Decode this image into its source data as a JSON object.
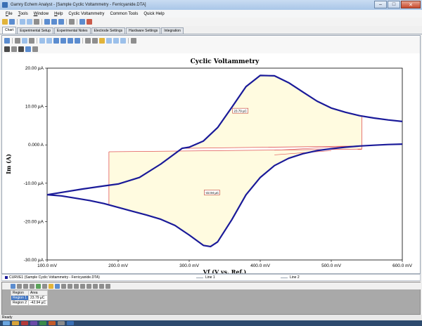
{
  "window": {
    "title": "Gamry Echem Analyst - [Sample Cyclic Voltammetry - Ferricyanide.DTA]",
    "minimize_glyph": "–",
    "maximize_glyph": "□",
    "close_glyph": "✕"
  },
  "menu": {
    "items": [
      {
        "key": "F",
        "rest": "ile"
      },
      {
        "key": "T",
        "rest": "ools"
      },
      {
        "key": "W",
        "rest": "indow"
      },
      {
        "key": "H",
        "rest": "elp"
      },
      {
        "key": "",
        "rest": "Cyclic Voltammetry"
      },
      {
        "key": "",
        "rest": "Common Tools"
      },
      {
        "key": "",
        "rest": "Quick Help"
      }
    ]
  },
  "tabs": [
    {
      "label": "Chart",
      "active": true
    },
    {
      "label": "Experimental Setup",
      "active": false
    },
    {
      "label": "Experimental Notes",
      "active": false
    },
    {
      "label": "Electrode Settings",
      "active": false
    },
    {
      "label": "Hardware Settings",
      "active": false
    },
    {
      "label": "Integration",
      "active": false
    }
  ],
  "chart_data": {
    "type": "line",
    "title": "Cyclic Voltammetry",
    "xlabel": "Vf (V vs. Ref.)",
    "ylabel": "Im (A)",
    "xlim": [
      100,
      600
    ],
    "ylim": [
      -30,
      20
    ],
    "x_unit": "mV",
    "y_unit": "µA",
    "x_ticks": [
      {
        "value": 100,
        "label": "100.0 mV"
      },
      {
        "value": 200,
        "label": "200.0 mV"
      },
      {
        "value": 300,
        "label": "300.0 mV"
      },
      {
        "value": 400,
        "label": "400.0 mV"
      },
      {
        "value": 500,
        "label": "500.0 mV"
      },
      {
        "value": 600,
        "label": "600.0 mV"
      }
    ],
    "y_ticks": [
      {
        "value": 20,
        "label": "20.00 µA"
      },
      {
        "value": 10,
        "label": "10.00 µA"
      },
      {
        "value": 0,
        "label": "0.000 A"
      },
      {
        "value": -10,
        "label": "-10.00 µA"
      },
      {
        "value": -20,
        "label": "-20.00 µA"
      },
      {
        "value": -30,
        "label": "-30.00 µA"
      }
    ],
    "series": [
      {
        "name": "CURVE1 (Sample Cyclic Voltammetry - Ferricyanide.DTA)",
        "color": "#1a1a99",
        "x": [
          100,
          120,
          150,
          180,
          200,
          230,
          260,
          290,
          300,
          320,
          340,
          360,
          380,
          400,
          420,
          440,
          460,
          480,
          500,
          520,
          540,
          560,
          580,
          600
        ],
        "y": [
          -13,
          -12.4,
          -11.5,
          -10.7,
          -10.2,
          -8.5,
          -5.0,
          -0.9,
          -0.6,
          1.0,
          4.5,
          9.8,
          15.2,
          18.1,
          18.0,
          16.2,
          13.8,
          11.4,
          9.6,
          8.5,
          7.6,
          7.0,
          6.5,
          6.1
        ]
      },
      {
        "name": "",
        "color": "#1a1a99",
        "x": [
          600,
          580,
          560,
          540,
          520,
          500,
          480,
          460,
          440,
          420,
          400,
          380,
          360,
          340,
          330,
          320,
          300,
          280,
          260,
          240,
          220,
          200,
          180,
          160,
          140,
          120,
          100
        ],
        "y": [
          0.2,
          0.1,
          -0.1,
          -0.3,
          -0.6,
          -1.0,
          -1.5,
          -2.3,
          -3.5,
          -5.4,
          -8.5,
          -13.0,
          -19.5,
          -25.3,
          -26.5,
          -26.2,
          -23.5,
          -21.0,
          -19.4,
          -18.3,
          -17.3,
          -16.3,
          -15.3,
          -14.5,
          -13.9,
          -13.3,
          -13
        ]
      }
    ],
    "regions": [
      {
        "label": "23.79 µC",
        "color": "#fffbe0",
        "x_range": [
          289,
          543
        ],
        "baseline": [
          [
            289,
            -0.9
          ],
          [
            543,
            -0.3
          ]
        ]
      },
      {
        "label": "-42.94 µC",
        "color": "#fffbe0",
        "x_range": [
          187,
          543
        ],
        "baseline": [
          [
            187,
            -1.8
          ],
          [
            543,
            -1.1
          ]
        ]
      }
    ],
    "grid": false,
    "legend": "bottom"
  },
  "legend": {
    "curve": "CURVE1 (Sample Cyclic Voltammetry - Ferricyanide.DTA)",
    "line1": "Line 1",
    "line2": "Line 2"
  },
  "regions_table": {
    "headers": [
      "Region",
      "Area"
    ],
    "rows": [
      {
        "region": "Region 1",
        "area": "23.79 µC"
      },
      {
        "region": "Region 2",
        "area": "-42.94 µC"
      }
    ]
  },
  "status": {
    "text": "Ready"
  },
  "colors": {
    "curve": "#1a1a99",
    "baseline": "#e05555",
    "fill": "#fffbe0",
    "selection": "#3d73c2"
  }
}
